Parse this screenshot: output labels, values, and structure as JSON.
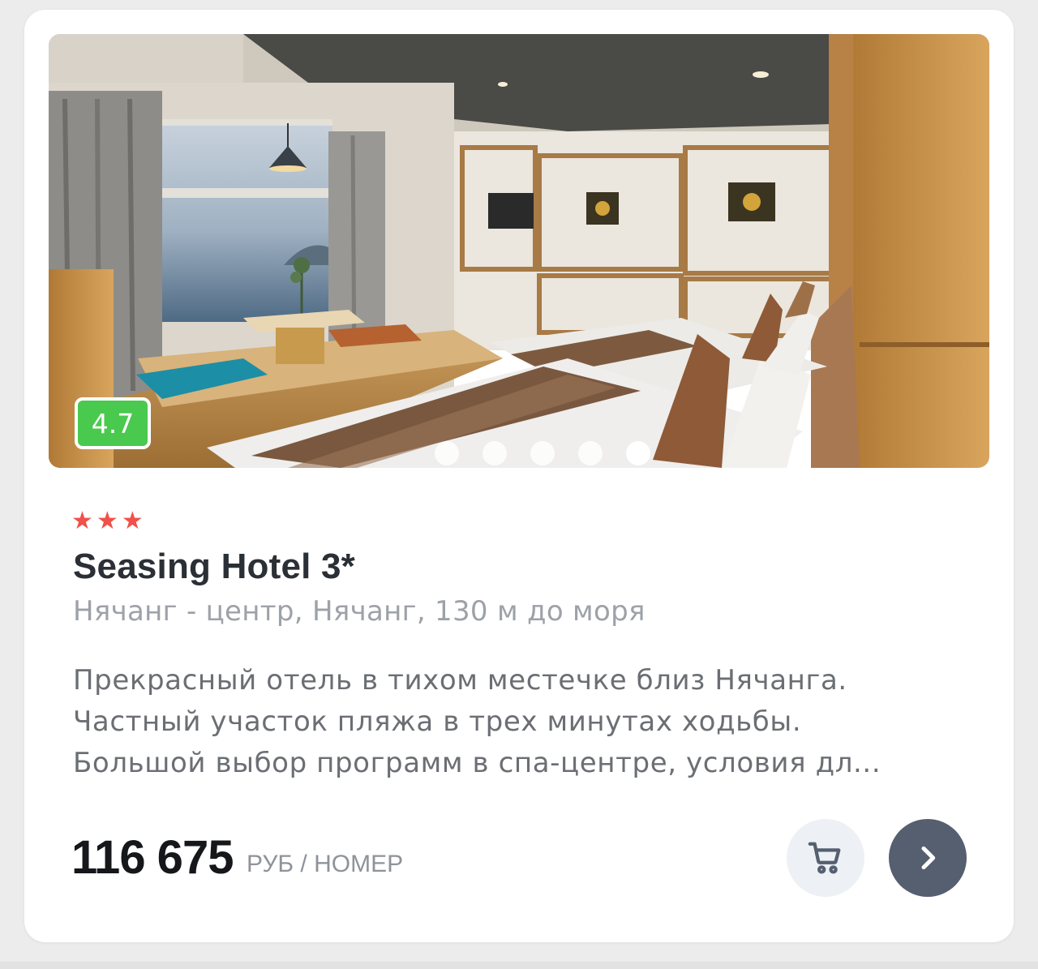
{
  "hotel": {
    "rating": "4.7",
    "stars": [
      "★",
      "★",
      "★"
    ],
    "star_count": 3,
    "name": "Seasing Hotel 3*",
    "location": "Нячанг - центр, Нячанг, 130 м до моря",
    "description_lines": [
      "Прекрасный отель в тихом местечке близ Нячанга.",
      "Частный участок пляжа в трех минутах ходьбы.",
      "Большой выбор программ в спа-центре, условия дл..."
    ],
    "price": "116 675",
    "price_unit": "РУБ / НОМЕР"
  },
  "gallery": {
    "image_count": 5,
    "active_index": 4
  },
  "icons": {
    "cart": "shopping-cart-icon",
    "next": "chevron-right-icon",
    "star": "star-icon"
  },
  "colors": {
    "rating_badge": "#49c94d",
    "star": "#f0514a",
    "next_button": "#555f70",
    "cart_button": "#edf0f4"
  }
}
